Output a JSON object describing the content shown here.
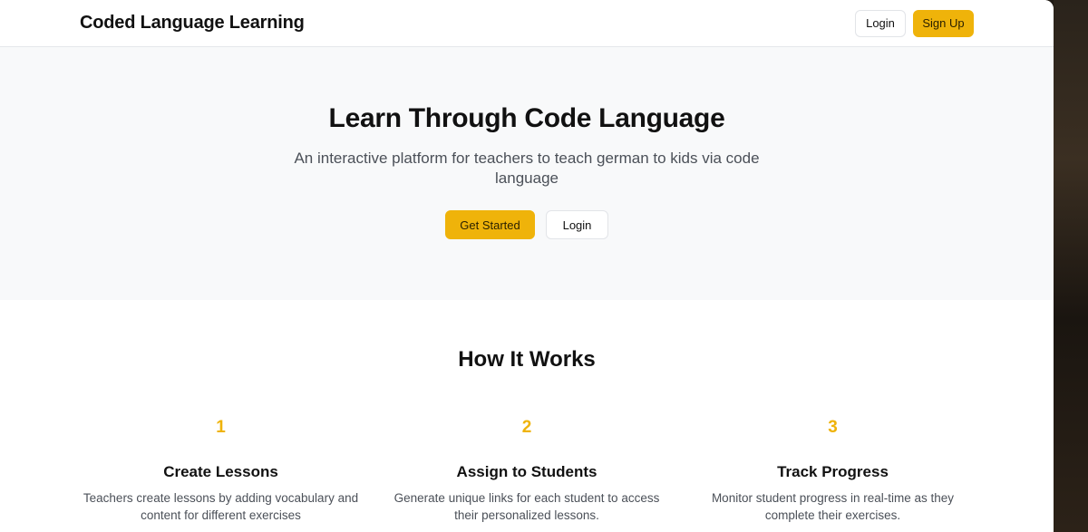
{
  "navbar": {
    "brand": "Coded Language Learning",
    "login_label": "Login",
    "signup_label": "Sign Up"
  },
  "hero": {
    "title": "Learn Through Code Language",
    "subtitle": "An interactive platform for teachers to teach german to kids via code language",
    "get_started_label": "Get Started",
    "login_label": "Login"
  },
  "how": {
    "title": "How It Works",
    "steps": [
      {
        "number": "1",
        "title": "Create Lessons",
        "description": "Teachers create lessons by adding vocabulary and content for different exercises"
      },
      {
        "number": "2",
        "title": "Assign to Students",
        "description": "Generate unique links for each student to access their personalized lessons."
      },
      {
        "number": "3",
        "title": "Track Progress",
        "description": "Monitor student progress in real-time as they complete their exercises."
      }
    ]
  },
  "colors": {
    "accent": "#efb30a",
    "hero_bg": "#f8f9fa",
    "text": "#111111",
    "muted": "#4b5058"
  }
}
